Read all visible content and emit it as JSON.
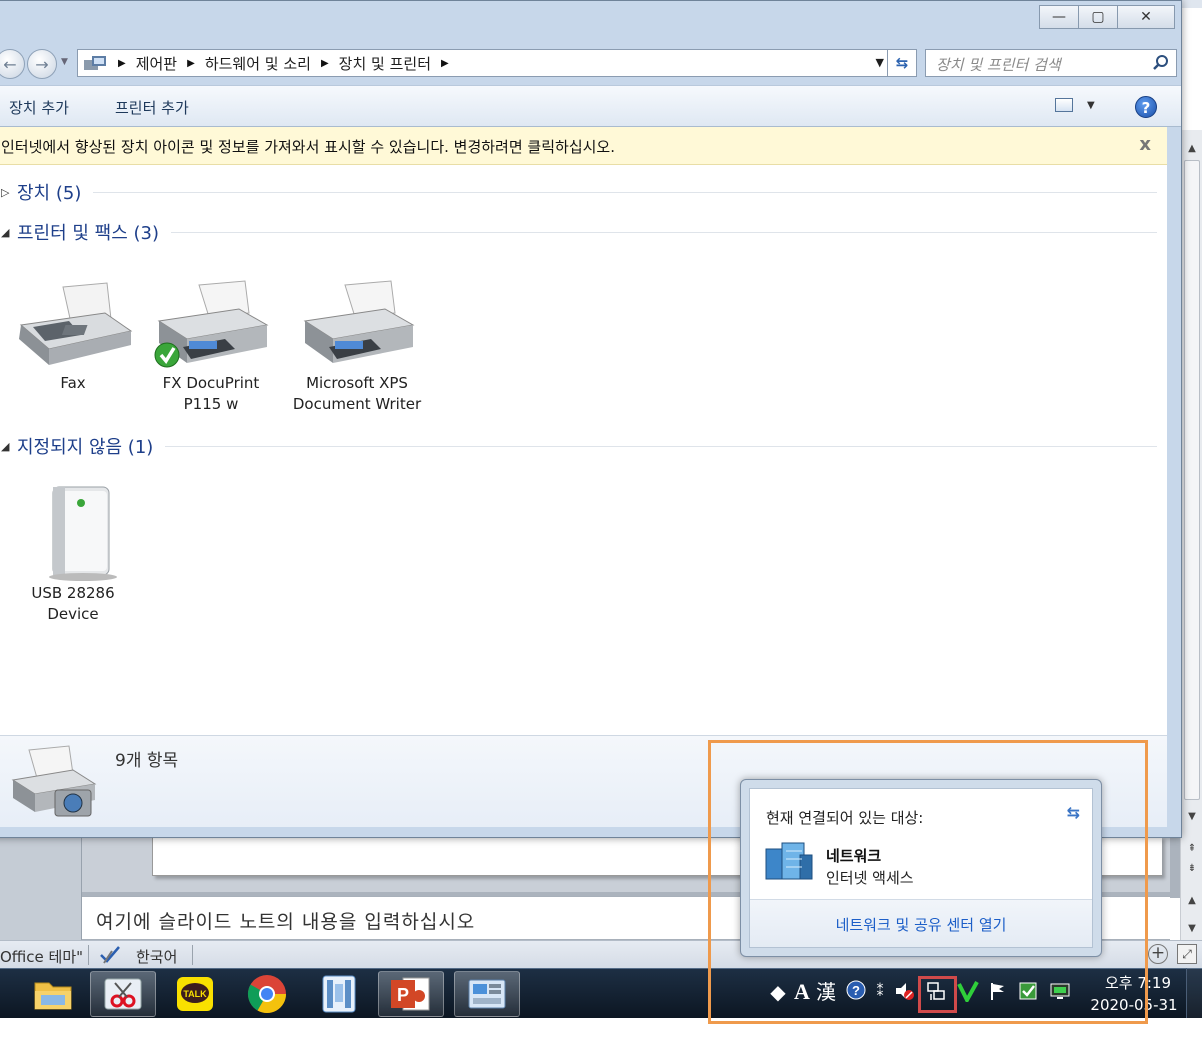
{
  "window": {
    "controls": {
      "minimize": "—",
      "maximize": "▢",
      "close": "✕"
    }
  },
  "address": {
    "crumbs": [
      "제어판",
      "하드웨어 및 소리",
      "장치 및 프린터"
    ],
    "search_placeholder": "장치 및 프린터 검색"
  },
  "toolbar": {
    "add_device": "장치 추가",
    "add_printer": "프린터 추가"
  },
  "infobar": {
    "text": "인터넷에서 향상된 장치 아이콘 및 정보를 가져와서 표시할 수 있습니다. 변경하려면 클릭하십시오.",
    "close": "x"
  },
  "groups": {
    "devices": "장치 (5)",
    "printers": "프린터 및 팩스 (3)",
    "unspecified": "지정되지 않음 (1)"
  },
  "devices": {
    "fax": "Fax",
    "fx_line1": "FX DocuPrint",
    "fx_line2": "P115 w",
    "xps_line1": "Microsoft XPS",
    "xps_line2": "Document Writer",
    "usb_line1": "USB 28286",
    "usb_line2": "Device"
  },
  "details": {
    "count": "9개 항목"
  },
  "ppt": {
    "notes_placeholder": "여기에 슬라이드 노트의 내용을 입력하십시오",
    "theme": "Office 테마\"",
    "language": "한국어"
  },
  "flyout": {
    "header": "현재 연결되어 있는 대상:",
    "network_name": "네트워크",
    "network_status": "인터넷 액세스",
    "link": "네트워크 및 공유 센터 열기"
  },
  "tray": {
    "ime_a": "A",
    "ime_han": "漢"
  },
  "clock": {
    "time": "오후 7:19",
    "date": "2020-05-31"
  },
  "colors": {
    "link": "#1d5fc8",
    "group_title": "#1e3f8a",
    "infobar_bg": "#fff9d7",
    "highlight": "#ef9a4c",
    "tray_highlight": "#d04a4a"
  }
}
